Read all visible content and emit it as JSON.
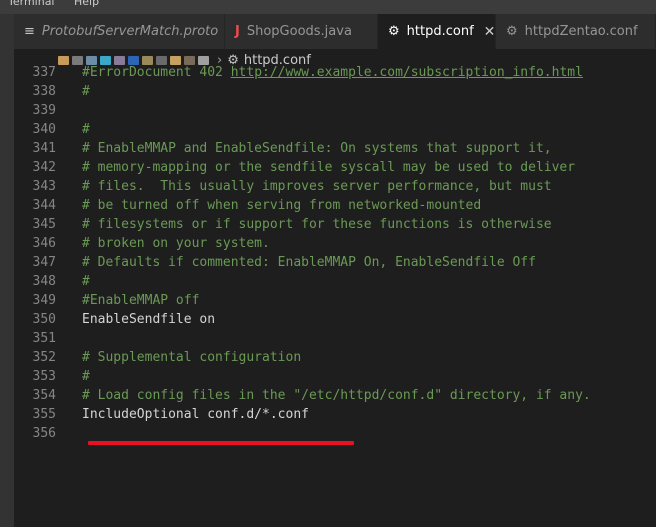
{
  "menu": {
    "terminal": "Terminal",
    "help": "Help"
  },
  "tabs": [
    {
      "label": "ProtobufServerMatch.proto",
      "icon": "list-icon",
      "active": false
    },
    {
      "label": "ShopGoods.java",
      "icon": "java-icon",
      "active": false
    },
    {
      "label": "httpd.conf",
      "icon": "gear-icon",
      "active": true
    },
    {
      "label": "httpdZentao.conf",
      "icon": "gear-icon",
      "active": false
    }
  ],
  "breadcrumb": {
    "file": "httpd.conf"
  },
  "editor": {
    "lines": [
      {
        "num": "337",
        "text": "#ErrorDocument 402 http://www.example.com/subscription_info.html",
        "kind": "comment"
      },
      {
        "num": "338",
        "text": "#",
        "kind": "comment"
      },
      {
        "num": "339",
        "text": "",
        "kind": "plain"
      },
      {
        "num": "340",
        "text": "#",
        "kind": "comment"
      },
      {
        "num": "341",
        "text": "# EnableMMAP and EnableSendfile: On systems that support it,",
        "kind": "comment"
      },
      {
        "num": "342",
        "text": "# memory-mapping or the sendfile syscall may be used to deliver",
        "kind": "comment"
      },
      {
        "num": "343",
        "text": "# files.  This usually improves server performance, but must",
        "kind": "comment"
      },
      {
        "num": "344",
        "text": "# be turned off when serving from networked-mounted",
        "kind": "comment"
      },
      {
        "num": "345",
        "text": "# filesystems or if support for these functions is otherwise",
        "kind": "comment"
      },
      {
        "num": "346",
        "text": "# broken on your system.",
        "kind": "comment"
      },
      {
        "num": "347",
        "text": "# Defaults if commented: EnableMMAP On, EnableSendfile Off",
        "kind": "comment"
      },
      {
        "num": "348",
        "text": "#",
        "kind": "comment"
      },
      {
        "num": "349",
        "text": "#EnableMMAP off",
        "kind": "comment"
      },
      {
        "num": "350",
        "text": "EnableSendfile on",
        "kind": "plain"
      },
      {
        "num": "351",
        "text": "",
        "kind": "plain"
      },
      {
        "num": "352",
        "text": "# Supplemental configuration",
        "kind": "comment"
      },
      {
        "num": "353",
        "text": "#",
        "kind": "comment"
      },
      {
        "num": "354",
        "text": "# Load config files in the \"/etc/httpd/conf.d\" directory, if any.",
        "kind": "comment"
      },
      {
        "num": "355",
        "text": "IncludeOptional conf.d/*.conf",
        "kind": "plain"
      },
      {
        "num": "356",
        "text": "",
        "kind": "plain"
      }
    ]
  },
  "colors": {
    "accent_underline": "#e81123",
    "comment": "#6a9955",
    "java_icon": "#f14c4c"
  }
}
